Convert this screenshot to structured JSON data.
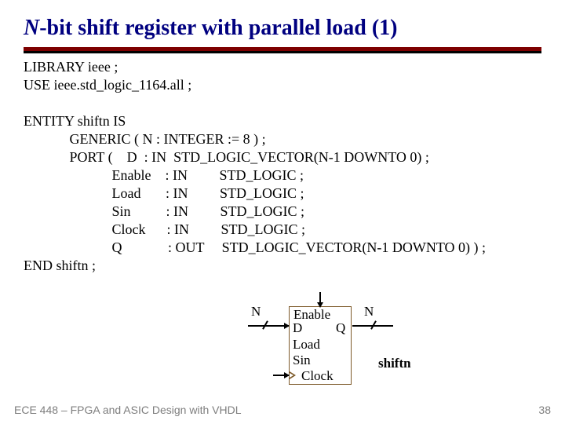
{
  "title": {
    "italic": "N",
    "rest": "-bit shift register with parallel load (1)"
  },
  "code": {
    "l1": "LIBRARY ieee ;",
    "l2": "USE ieee.std_logic_1164.all ;",
    "l3": "",
    "l4": "ENTITY shiftn IS",
    "l5": "             GENERIC ( N : INTEGER := 8 ) ;",
    "l6": "             PORT (    D  : IN  STD_LOGIC_VECTOR(N-1 DOWNTO 0) ;",
    "l7": "                         Enable    : IN         STD_LOGIC ;",
    "l8": "                         Load       : IN         STD_LOGIC ;",
    "l9": "                         Sin          : IN         STD_LOGIC ;",
    "l10": "                         Clock      : IN         STD_LOGIC ;",
    "l11": "                         Q             : OUT     STD_LOGIC_VECTOR(N-1 DOWNTO 0) ) ;",
    "l12": "END shiftn ;"
  },
  "diagram": {
    "n_left": "N",
    "n_right": "N",
    "enable": "Enable",
    "d": "D",
    "q": "Q",
    "load": "Load",
    "sin": "Sin",
    "clock": "Clock",
    "name": "shiftn"
  },
  "footer": "ECE 448 – FPGA and ASIC Design with VHDL",
  "page": "38"
}
